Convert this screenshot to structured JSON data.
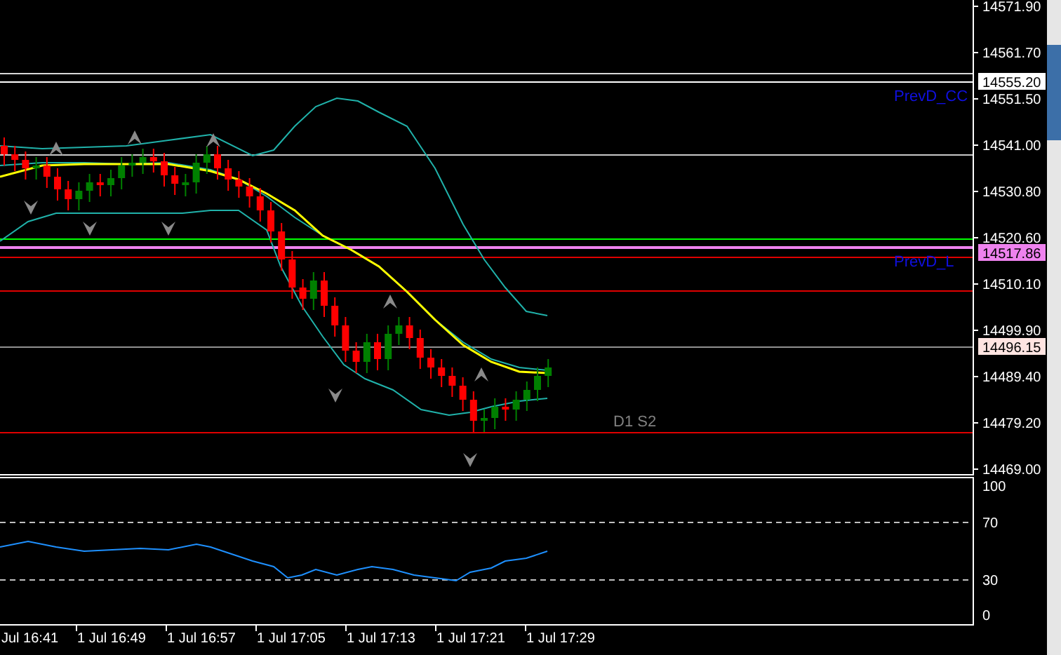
{
  "price_axis": {
    "labels": [
      "14571.90",
      "14561.70",
      "14551.50",
      "14541.00",
      "14530.80",
      "14520.60",
      "14510.10",
      "14499.90",
      "14489.40",
      "14479.20",
      "14469.00"
    ],
    "badges": [
      {
        "text": "14555.20",
        "color": "#ffffff"
      },
      {
        "text": "14517.86",
        "color": "#ee82ee"
      },
      {
        "text": "14496.15",
        "color": "#ffe4e1"
      }
    ]
  },
  "chart_labels": [
    {
      "text": "PrevD_CC",
      "color": "#1010e0"
    },
    {
      "text": "PrevD_L",
      "color": "#1010e0"
    },
    {
      "text": "D1 S2",
      "color": "#808080"
    }
  ],
  "indicator_axis": {
    "labels": [
      "100",
      "70",
      "30",
      "0"
    ]
  },
  "time_axis": {
    "labels": [
      "Jul 16:41",
      "1 Jul 16:49",
      "1 Jul 16:57",
      "1 Jul 17:05",
      "1 Jul 17:13",
      "1 Jul 17:21",
      "1 Jul 17:29"
    ]
  }
}
